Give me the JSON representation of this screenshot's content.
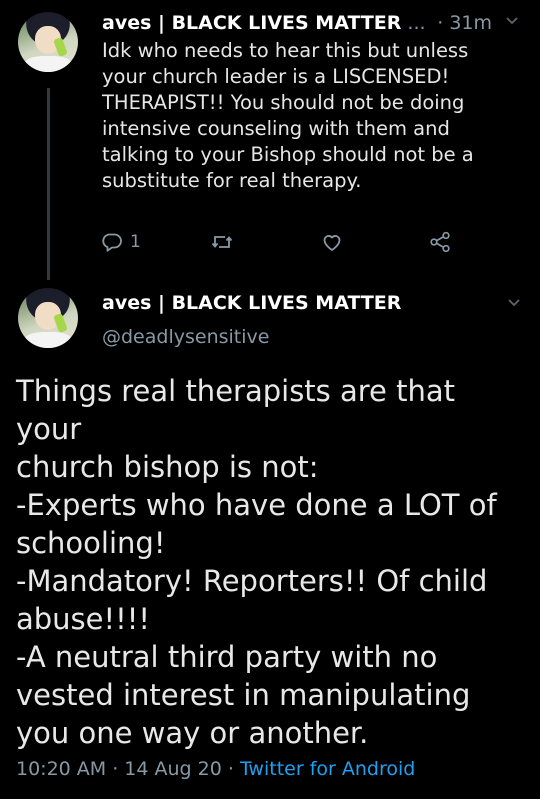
{
  "colors": {
    "background": "#000000",
    "secondary_text": "#8899a6",
    "link": "#1da1f2"
  },
  "tweet1": {
    "display_name": "aves | BLACK LIVES MATTER",
    "truncation": "...",
    "time": "· 31m",
    "text": "Idk who needs to hear this but unless\nyour church leader is a LISCENSED!\nTHERAPIST!! You should not be doing\nintensive counseling with them and\ntalking to your Bishop should not be a\nsubstitute for real therapy.",
    "reply_count": "1",
    "icons": [
      "reply-icon",
      "retweet-icon",
      "like-icon",
      "share-icon",
      "chevron-down-icon"
    ]
  },
  "tweet2": {
    "display_name": "aves | BLACK LIVES MATTER",
    "handle": "@deadlysensitive",
    "text": "Things real therapists are that your\nchurch bishop is not:\n-Experts who have done a LOT of\nschooling!\n-Mandatory! Reporters!! Of child\nabuse!!!!\n-A neutral third party with no\nvested interest in manipulating\nyou one way or another.",
    "meta_time": "10:20 AM · 14 Aug 20 · ",
    "meta_source": "Twitter for Android"
  }
}
